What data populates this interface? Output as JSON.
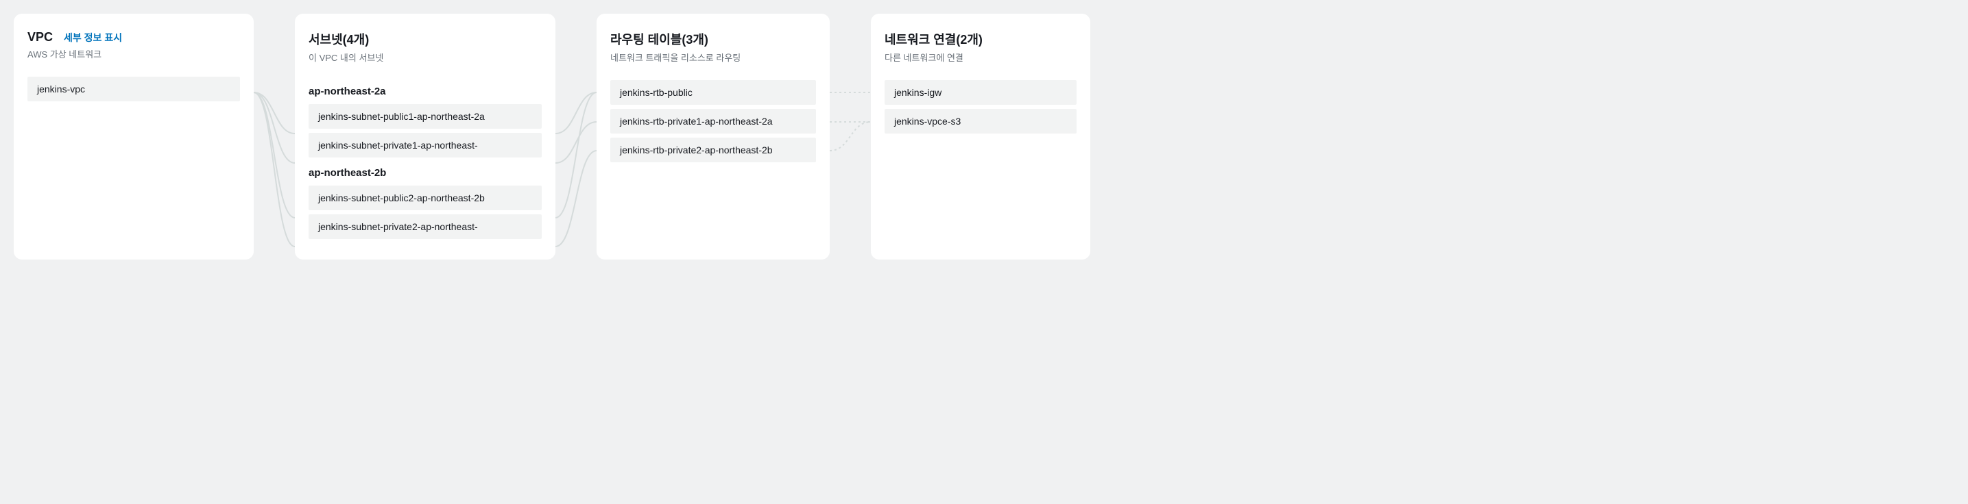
{
  "vpc": {
    "title": "VPC",
    "detailsLink": "세부 정보 표시",
    "subtitle": "AWS 가상 네트워크",
    "item": "jenkins-vpc"
  },
  "subnets": {
    "title": "서브넷(4개)",
    "subtitle": "이 VPC 내의 서브넷",
    "groups": [
      {
        "label": "ap-northeast-2a",
        "items": [
          "jenkins-subnet-public1-ap-northeast-2a",
          "jenkins-subnet-private1-ap-northeast-"
        ]
      },
      {
        "label": "ap-northeast-2b",
        "items": [
          "jenkins-subnet-public2-ap-northeast-2b",
          "jenkins-subnet-private2-ap-northeast-"
        ]
      }
    ]
  },
  "routes": {
    "title": "라우팅 테이블(3개)",
    "subtitle": "네트워크 트래픽을 리소스로 라우팅",
    "items": [
      "jenkins-rtb-public",
      "jenkins-rtb-private1-ap-northeast-2a",
      "jenkins-rtb-private2-ap-northeast-2b"
    ]
  },
  "connections": {
    "title": "네트워크 연결(2개)",
    "subtitle": "다른 네트워크에 연결",
    "items": [
      "jenkins-igw",
      "jenkins-vpce-s3"
    ]
  }
}
